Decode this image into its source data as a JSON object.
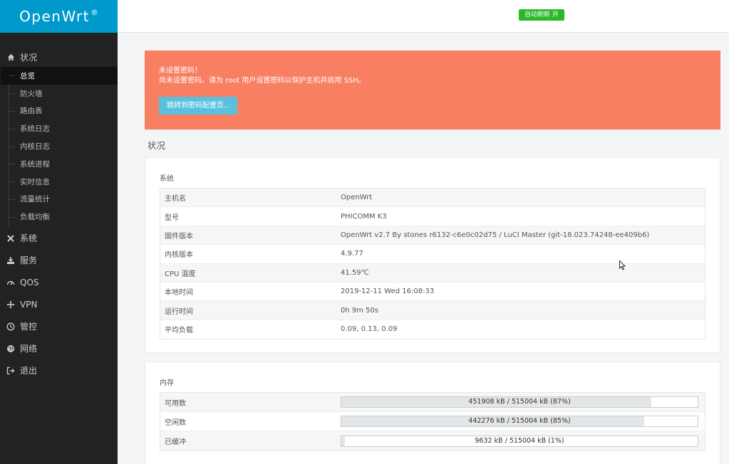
{
  "brand": {
    "name": "OpenWrt",
    "reg": "®"
  },
  "topbar": {
    "refresh_label": "自动刷新 开"
  },
  "nav": {
    "status": "状况",
    "status_items": [
      "总览",
      "防火墙",
      "路由表",
      "系统日志",
      "内核日志",
      "系统进程",
      "实时信息",
      "流量统计",
      "负载均衡"
    ],
    "system": "系统",
    "services": "服务",
    "qos": "QOS",
    "vpn": "VPN",
    "control": "管控",
    "network": "网络",
    "logout": "退出"
  },
  "alert": {
    "line1": "未设置密码！",
    "line2": "尚未设置密码。请为 root 用户设置密码以保护主机并启用 SSH。",
    "button": "跳转到密码配置页..."
  },
  "page_title": "状况",
  "system": {
    "title": "系统",
    "rows": [
      {
        "key": "主机名",
        "value": "OpenWrt"
      },
      {
        "key": "型号",
        "value": "PHICOMM K3"
      },
      {
        "key": "固件版本",
        "value": "OpenWrt v2.7 By stones r6132-c6e0c02d75 / LuCI Master (git-18.023.74248-ee409b6)"
      },
      {
        "key": "内核版本",
        "value": "4.9.77"
      },
      {
        "key": "CPU 温度",
        "value": "41.59℃"
      },
      {
        "key": "本地时间",
        "value": "2019-12-11 Wed 16:08:33"
      },
      {
        "key": "运行时间",
        "value": "0h 9m 50s"
      },
      {
        "key": "平均负载",
        "value": "0.09, 0.13, 0.09"
      }
    ]
  },
  "memory": {
    "title": "内存",
    "rows": [
      {
        "key": "可用数",
        "text": "451908 kB / 515004 kB (87%)",
        "percent": 87
      },
      {
        "key": "空闲数",
        "text": "442276 kB / 515004 kB (85%)",
        "percent": 85
      },
      {
        "key": "已缓冲",
        "text": "9632 kB / 515004 kB (1%)",
        "percent": 1
      }
    ]
  },
  "colors": {
    "brand": "#0099cc",
    "alert": "#f97f63",
    "alert_button": "#5bc0de",
    "refresh": "#28b828"
  }
}
